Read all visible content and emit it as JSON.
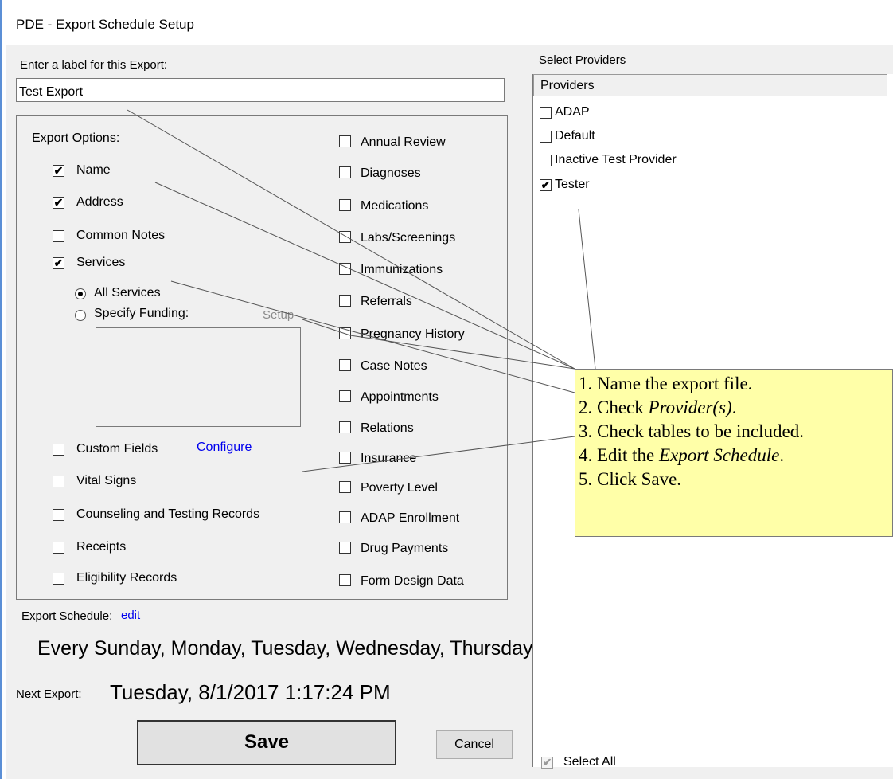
{
  "window": {
    "title": "PDE - Export Schedule Setup"
  },
  "label_section": {
    "prompt": "Enter a label for this Export:",
    "value": "Test Export"
  },
  "export_options": {
    "heading": "Export Options:",
    "left_column": [
      {
        "label": "Name",
        "checked": true
      },
      {
        "label": "Address",
        "checked": true
      },
      {
        "label": "Common Notes",
        "checked": false
      },
      {
        "label": "Services",
        "checked": true
      }
    ],
    "services_scope": {
      "all_services": "All Services",
      "specify_funding": "Specify Funding:",
      "setup_link": "Setup",
      "selected": "all_services"
    },
    "left_column_lower": [
      {
        "label": "Custom Fields",
        "checked": false,
        "link": "Configure"
      },
      {
        "label": "Vital Signs",
        "checked": false
      },
      {
        "label": "Counseling and Testing Records",
        "checked": false
      },
      {
        "label": "Receipts",
        "checked": false
      },
      {
        "label": "Eligibility Records",
        "checked": false
      }
    ],
    "right_column": [
      {
        "label": "Annual Review",
        "checked": false
      },
      {
        "label": "Diagnoses",
        "checked": false
      },
      {
        "label": "Medications",
        "checked": false
      },
      {
        "label": "Labs/Screenings",
        "checked": false
      },
      {
        "label": "Immunizations",
        "checked": false
      },
      {
        "label": "Referrals",
        "checked": false
      },
      {
        "label": "Pregnancy History",
        "checked": false
      },
      {
        "label": "Case Notes",
        "checked": false
      },
      {
        "label": "Appointments",
        "checked": false
      },
      {
        "label": "Relations",
        "checked": false
      },
      {
        "label": "Insurance",
        "checked": false
      },
      {
        "label": "Poverty Level",
        "checked": false
      },
      {
        "label": "ADAP Enrollment",
        "checked": false
      },
      {
        "label": "Drug Payments",
        "checked": false
      },
      {
        "label": "Form Design Data",
        "checked": false
      }
    ]
  },
  "schedule": {
    "label": "Export Schedule:",
    "edit_link": "edit",
    "summary": "Every Sunday, Monday, Tuesday, Wednesday, Thursday",
    "next_label": "Next Export:",
    "next_value": "Tuesday, 8/1/2017 1:17:24 PM"
  },
  "buttons": {
    "save": "Save",
    "cancel": "Cancel"
  },
  "providers": {
    "section_title": "Select Providers",
    "column_header": "Providers",
    "items": [
      {
        "label": "ADAP",
        "checked": false
      },
      {
        "label": "Default",
        "checked": false
      },
      {
        "label": "Inactive Test Provider",
        "checked": false
      },
      {
        "label": "Tester",
        "checked": true
      }
    ],
    "select_all": "Select All",
    "select_all_checked": true
  },
  "callout": {
    "line1": "1. Name the export file.",
    "line2_prefix": "2. Check ",
    "line2_em": "Provider(s)",
    "line2_suffix": ".",
    "line3": "3. Check tables to be included.",
    "line4_prefix": "4. Edit the ",
    "line4_em": "Export Schedule",
    "line4_suffix": ".",
    "line5": "5. Click Save."
  },
  "icons": {
    "check_glyph": "✔"
  }
}
